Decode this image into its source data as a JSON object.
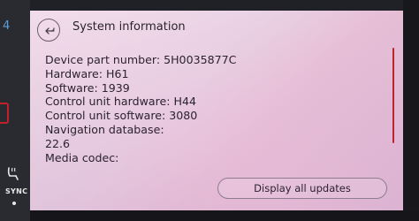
{
  "bezel": {
    "number": "4",
    "sync_label": "SYNC"
  },
  "header": {
    "title": "System information"
  },
  "info_lines": [
    "Device part number: 5H0035877C",
    "Hardware: H61",
    "Software: 1939",
    "Control unit hardware: H44",
    "Control unit software: 3080",
    "Navigation database:",
    "22.6",
    "Media codec:"
  ],
  "footer": {
    "updates_button_label": "Display all updates"
  },
  "colors": {
    "accent_red": "#c2202a",
    "text": "#2b2230"
  },
  "icons": {
    "back": "back-arrow-icon",
    "seat": "heated-seat-icon"
  }
}
